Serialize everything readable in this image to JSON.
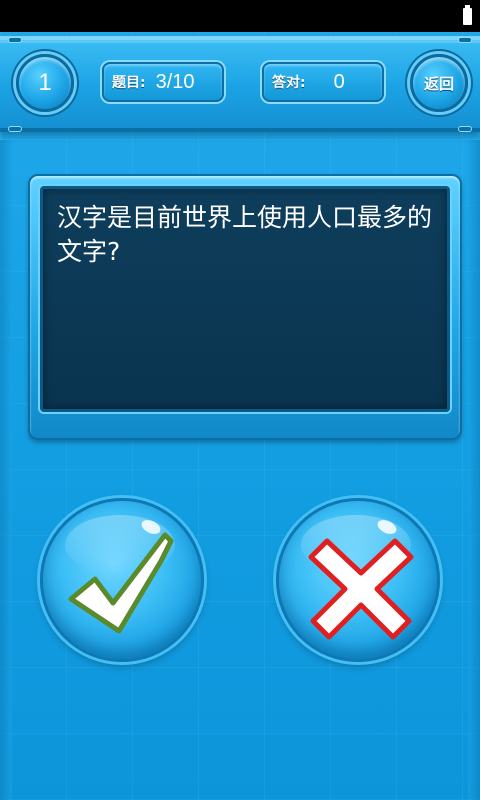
{
  "header": {
    "level": "1",
    "question_label": "题目:",
    "question_progress": "3/10",
    "correct_label": "答对:",
    "correct_count": "0",
    "back_label": "返回"
  },
  "question": {
    "text": "汉字是目前世界上使用人口最多的文字?"
  },
  "answers": {
    "true_icon": "check-icon",
    "false_icon": "cross-icon"
  },
  "colors": {
    "background": "#1aa3e6",
    "question_screen": "#0e3e5c",
    "check_fill": "#ffffff",
    "check_stroke": "#5a8a2a",
    "cross_fill": "#ffffff",
    "cross_stroke": "#e02020"
  }
}
